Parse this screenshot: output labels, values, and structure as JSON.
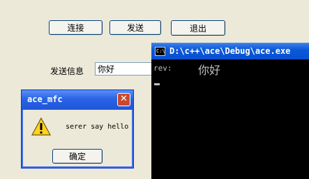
{
  "main": {
    "connect_label": "连接",
    "send_label": "发送",
    "exit_label": "退出",
    "send_info_label": "发送信息",
    "send_info_value": "你好"
  },
  "console": {
    "title": "D:\\c++\\ace\\Debug\\ace.exe",
    "icon_text": "C:\\",
    "prefix": "rev:",
    "message": "你好"
  },
  "msgbox": {
    "title": "ace_mfc",
    "text": "serer say hello",
    "ok_label": "确定",
    "icon": "warning-icon"
  }
}
